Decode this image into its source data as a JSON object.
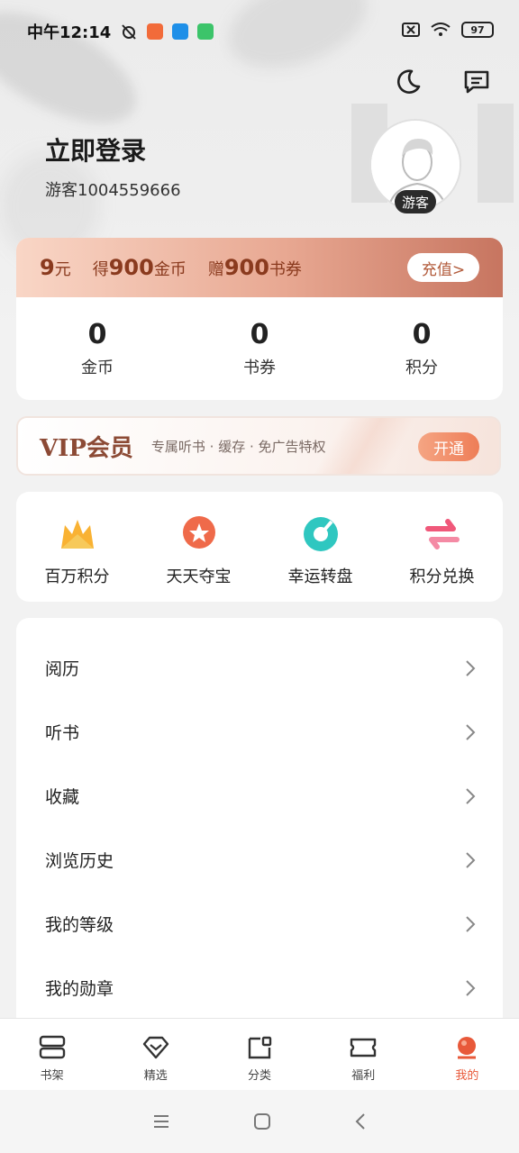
{
  "status_bar": {
    "time": "中午12:14",
    "battery": "97"
  },
  "profile": {
    "login_title": "立即登录",
    "guest_id": "游客1004559666",
    "avatar_badge": "游客"
  },
  "coin_card": {
    "offer": [
      {
        "num": "9",
        "unit": "元"
      },
      {
        "prefix": "得",
        "num": "900",
        "unit": "金币"
      },
      {
        "prefix": "赠",
        "num": "900",
        "unit": "书券"
      }
    ],
    "recharge_label": "充值>",
    "stats": [
      {
        "value": "0",
        "label": "金币"
      },
      {
        "value": "0",
        "label": "书券"
      },
      {
        "value": "0",
        "label": "积分"
      }
    ]
  },
  "vip": {
    "title": "VIP会员",
    "desc": "专属听书 · 缓存 · 免广告特权",
    "button": "开通"
  },
  "features": [
    {
      "label": "百万积分",
      "icon": "crown-icon"
    },
    {
      "label": "天天夺宝",
      "icon": "star-badge-icon"
    },
    {
      "label": "幸运转盘",
      "icon": "wheel-icon"
    },
    {
      "label": "积分兑换",
      "icon": "exchange-icon"
    }
  ],
  "menu": [
    {
      "label": "阅历"
    },
    {
      "label": "听书"
    },
    {
      "label": "收藏"
    },
    {
      "label": "浏览历史"
    },
    {
      "label": "我的等级"
    },
    {
      "label": "我的勋章"
    }
  ],
  "tabs": [
    {
      "label": "书架",
      "icon": "bookshelf-icon"
    },
    {
      "label": "精选",
      "icon": "diamond-icon"
    },
    {
      "label": "分类",
      "icon": "category-icon"
    },
    {
      "label": "福利",
      "icon": "ticket-icon"
    },
    {
      "label": "我的",
      "icon": "profile-icon",
      "active": true
    }
  ],
  "colors": {
    "accent": "#e8593a",
    "banner_text": "#8a3a1e",
    "vip_text": "#8c4a35"
  }
}
